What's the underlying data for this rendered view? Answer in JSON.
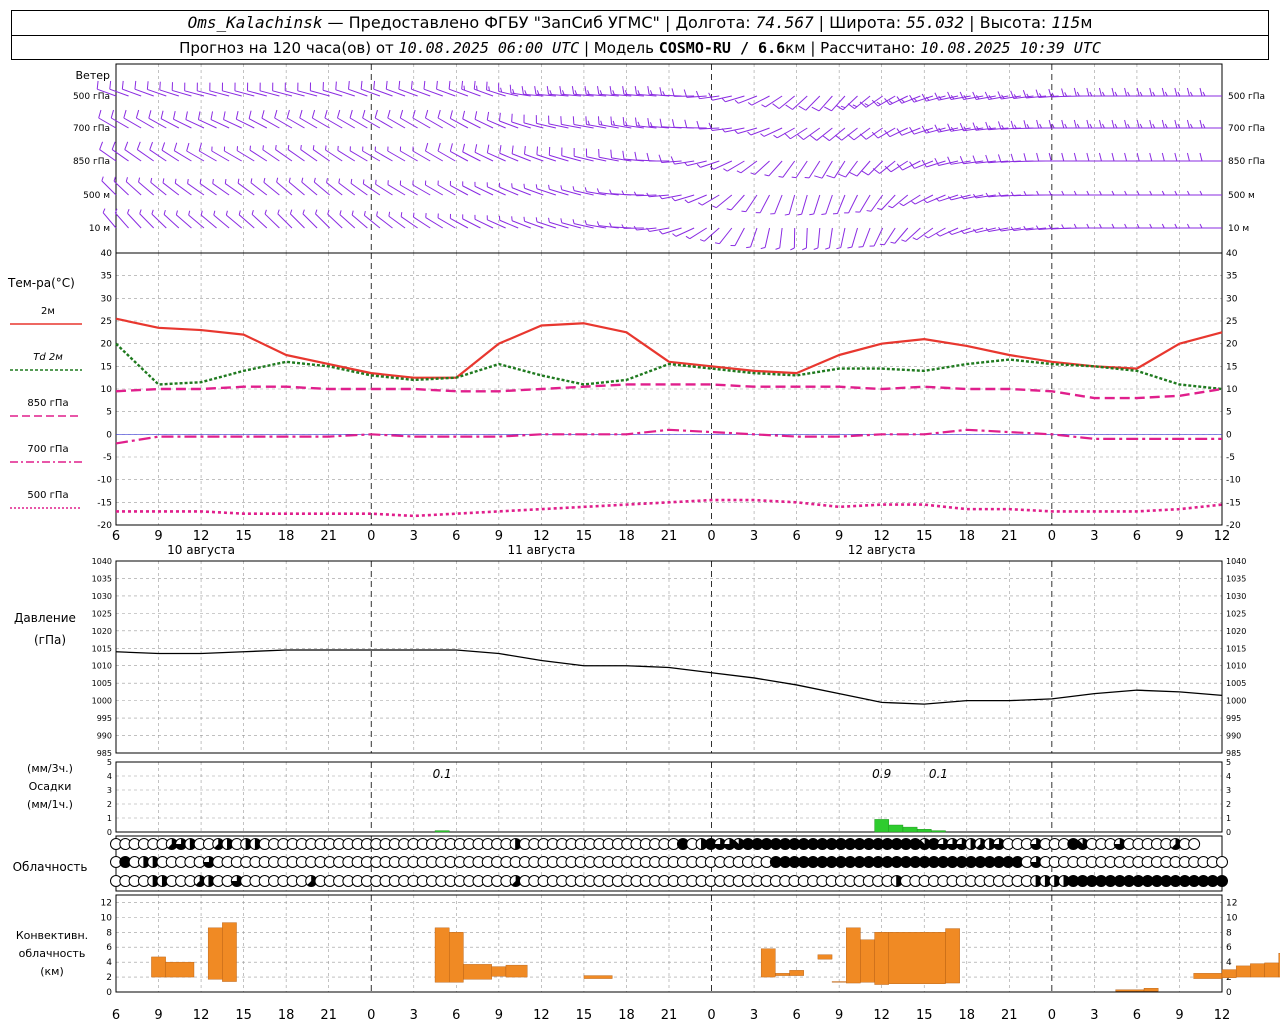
{
  "header": {
    "station": "Oms_Kalachinsk",
    "provided_by": "Предоставлено ФГБУ \"ЗапСиб УГМС\"",
    "lon_label": "Долгота:",
    "lon_value": "74.567",
    "lat_label": "Широта:",
    "lat_value": "55.032",
    "alt_label": "Высота:",
    "alt_value": "115",
    "alt_unit": "м",
    "forecast_label": "Прогноз на 120 часа(ов) от",
    "forecast_start": "10.08.2025 06:00 UTC",
    "model_label": "Модель",
    "model_name": "COSMO-RU / 6.6",
    "model_unit": "км",
    "calc_label": "Рассчитано:",
    "calc_time": "10.08.2025 10:39 UTC"
  },
  "colors": {
    "wind": "#8a2be2",
    "t2m": "#e8372f",
    "td2m": "#1f7a1f",
    "t850": "#e01f8c",
    "t700": "#e01f8c",
    "t500": "#e01f8c",
    "pressure": "#000000",
    "precip": "#2ecc2e",
    "convective": "#f08a24",
    "grid": "#9a9a9a"
  },
  "wind_panel": {
    "title": "Ветер",
    "levels": [
      "500 гПа",
      "700 гПа",
      "850 гПа",
      "500 м",
      "10  м"
    ]
  },
  "temp_panel": {
    "title": "Тем-ра(°C)",
    "legend": [
      "2м",
      "Td 2м",
      "850 гПа",
      "700 гПа",
      "500 гПа"
    ]
  },
  "pressure_panel": {
    "title": "Давление",
    "unit": "(гПа)"
  },
  "precip_panel": {
    "labels": [
      "(мм/3ч.)",
      "Осадки",
      "(мм/1ч.)"
    ]
  },
  "cloud_panel": {
    "title": "Облачность"
  },
  "conv_panel": {
    "labels": [
      "Конвективн.",
      "облачность",
      "(км)"
    ]
  },
  "time_axis": {
    "tick_labels": [
      "6",
      "9",
      "12",
      "15",
      "18",
      "21",
      "0",
      "3",
      "6",
      "9",
      "12",
      "15",
      "18",
      "21",
      "0",
      "3",
      "6",
      "9",
      "12",
      "15",
      "18",
      "21",
      "0",
      "3",
      "6",
      "9",
      "12"
    ],
    "dates": [
      "10 августа",
      "11 августа",
      "12 августа"
    ]
  },
  "chart_data": [
    {
      "type": "line",
      "name": "wind barbs",
      "x_hours": [
        0,
        3,
        6,
        9,
        12,
        15,
        18,
        21,
        24,
        27,
        30,
        33,
        36,
        39,
        42,
        45,
        48,
        51,
        54,
        57,
        60,
        63,
        66,
        69,
        72
      ],
      "levels": [
        "500 гПа",
        "700 гПа",
        "850 гПа",
        "500 м",
        "10  м"
      ],
      "direction_deg": [
        [
          290,
          290,
          285,
          285,
          285,
          285,
          290,
          290,
          290,
          290,
          275,
          275,
          275,
          275,
          265,
          250,
          230,
          220,
          235,
          250,
          260,
          260,
          265,
          270,
          270
        ],
        [
          300,
          300,
          295,
          295,
          300,
          300,
          300,
          300,
          300,
          295,
          285,
          280,
          280,
          275,
          270,
          255,
          240,
          230,
          235,
          250,
          260,
          265,
          270,
          270,
          270
        ],
        [
          305,
          305,
          300,
          300,
          305,
          305,
          300,
          300,
          300,
          295,
          290,
          285,
          280,
          270,
          255,
          235,
          215,
          210,
          225,
          245,
          260,
          265,
          270,
          270,
          270
        ],
        [
          315,
          310,
          305,
          305,
          310,
          310,
          305,
          300,
          300,
          295,
          290,
          285,
          275,
          265,
          245,
          215,
          195,
          200,
          215,
          240,
          255,
          265,
          270,
          270,
          270
        ],
        [
          320,
          315,
          310,
          310,
          315,
          315,
          310,
          305,
          300,
          295,
          290,
          285,
          275,
          260,
          235,
          200,
          180,
          190,
          205,
          230,
          250,
          260,
          265,
          270,
          270
        ]
      ],
      "speed_ms": [
        [
          12,
          12,
          12,
          11,
          10,
          10,
          10,
          11,
          12,
          13,
          14,
          15,
          16,
          16,
          10,
          6,
          8,
          12,
          14,
          14,
          15,
          16,
          16,
          16,
          16
        ],
        [
          10,
          10,
          10,
          9,
          8,
          8,
          8,
          9,
          10,
          11,
          11,
          12,
          13,
          13,
          9,
          6,
          7,
          10,
          12,
          12,
          13,
          13,
          14,
          14,
          14
        ],
        [
          8,
          8,
          8,
          7,
          6,
          6,
          6,
          7,
          8,
          8,
          8,
          9,
          10,
          10,
          7,
          5,
          6,
          8,
          9,
          9,
          10,
          10,
          10,
          10,
          10
        ],
        [
          6,
          6,
          6,
          5,
          5,
          5,
          5,
          5,
          6,
          6,
          6,
          6,
          7,
          7,
          5,
          5,
          5,
          6,
          6,
          6,
          7,
          7,
          7,
          7,
          7
        ],
        [
          4,
          4,
          4,
          3,
          3,
          3,
          3,
          3,
          4,
          4,
          4,
          4,
          5,
          4,
          3,
          3,
          3,
          4,
          4,
          4,
          5,
          5,
          5,
          5,
          5
        ]
      ]
    },
    {
      "type": "line",
      "title": "Тем-ра(°C)",
      "x_hours": [
        0,
        3,
        6,
        9,
        12,
        15,
        18,
        21,
        24,
        27,
        30,
        33,
        36,
        39,
        42,
        45,
        48,
        51,
        54,
        57,
        60,
        63,
        66,
        69,
        72,
        75,
        78
      ],
      "ylim": [
        -20,
        40
      ],
      "series": [
        {
          "name": "2м",
          "values": [
            25.5,
            23.5,
            23,
            22,
            17.5,
            15.5,
            13.5,
            12.5,
            12.5,
            20,
            24,
            24.5,
            22.5,
            16,
            15,
            14,
            13.5,
            17.5,
            20,
            21,
            19.5,
            17.5,
            16,
            15,
            14.5,
            20,
            22.5
          ]
        },
        {
          "name": "Td 2м",
          "values": [
            20,
            11,
            11.5,
            14,
            16,
            15,
            13,
            12,
            12.5,
            15.5,
            13,
            11,
            12,
            15.5,
            14.5,
            13.5,
            13,
            14.5,
            14.5,
            14,
            15.5,
            16.5,
            15.5,
            15,
            14,
            11,
            10
          ]
        },
        {
          "name": "850 гПа",
          "values": [
            9.5,
            10,
            10,
            10.5,
            10.5,
            10,
            10,
            10,
            9.5,
            9.5,
            10,
            10.5,
            11,
            11,
            11,
            10.5,
            10.5,
            10.5,
            10,
            10.5,
            10,
            10,
            9.5,
            8,
            8,
            8.5,
            10
          ]
        },
        {
          "name": "700 гПа",
          "values": [
            -2,
            -0.5,
            -0.5,
            -0.5,
            -0.5,
            -0.5,
            0,
            -0.5,
            -0.5,
            -0.5,
            0,
            0,
            0,
            1,
            0.5,
            0,
            -0.5,
            -0.5,
            0,
            0,
            1,
            0.5,
            0,
            -1,
            -1,
            -1,
            -1
          ]
        },
        {
          "name": "500 гПа",
          "values": [
            -17,
            -17,
            -17,
            -17.5,
            -17.5,
            -17.5,
            -17.5,
            -18,
            -17.5,
            -17,
            -16.5,
            -16,
            -15.5,
            -15,
            -14.5,
            -14.5,
            -15,
            -16,
            -15.5,
            -15.5,
            -16.5,
            -16.5,
            -17,
            -17,
            -17,
            -16.5,
            -15.5
          ]
        }
      ]
    },
    {
      "type": "line",
      "title": "Давление",
      "x_hours": [
        0,
        3,
        6,
        9,
        12,
        15,
        18,
        21,
        24,
        27,
        30,
        33,
        36,
        39,
        42,
        45,
        48,
        51,
        54,
        57,
        60,
        63,
        66,
        69,
        72,
        75,
        78
      ],
      "ylim": [
        985,
        1040
      ],
      "series": [
        {
          "name": "Давление",
          "values": [
            1014,
            1013.5,
            1013.5,
            1014,
            1014.5,
            1014.5,
            1014.5,
            1014.5,
            1014.5,
            1013.5,
            1011.5,
            1010,
            1010,
            1009.5,
            1008,
            1006.5,
            1004.5,
            1002,
            999.5,
            999,
            1000,
            1000,
            1000.5,
            1002,
            1003,
            1002.5,
            1001.5
          ]
        }
      ]
    },
    {
      "type": "bar",
      "title": "Осадки",
      "x_hours": [
        23,
        54,
        55,
        56,
        57,
        58
      ],
      "values": [
        0.1,
        0.9,
        0.5,
        0.35,
        0.2,
        0.1
      ],
      "annotations": [
        "0.1",
        "0.9",
        "0.1"
      ],
      "ylim": [
        0,
        5
      ]
    },
    {
      "type": "table",
      "title": "Облачность",
      "rows": [
        "high",
        "middle",
        "low"
      ],
      "cover_octas": [
        [
          0,
          0,
          0,
          0,
          0,
          0,
          5,
          6,
          4,
          0,
          0,
          5,
          4,
          0,
          4,
          4,
          0,
          0,
          0,
          0,
          0,
          0,
          0,
          0,
          0,
          0,
          0,
          0,
          0,
          0,
          0,
          0,
          0,
          0,
          0,
          0,
          0,
          0,
          0,
          0,
          0,
          0,
          0,
          4,
          0,
          0,
          0,
          0,
          0,
          0,
          0,
          0,
          0,
          0,
          0,
          0,
          0,
          0,
          0,
          0,
          0,
          8,
          0,
          4,
          8,
          6,
          6,
          7,
          8,
          8,
          8,
          8,
          8,
          8,
          8,
          8,
          8,
          8,
          8,
          8,
          8,
          8,
          8,
          8,
          8,
          8,
          8,
          7,
          8,
          6,
          6,
          6,
          4,
          5,
          4,
          6,
          0,
          0,
          0,
          6,
          0,
          0,
          0,
          8,
          7,
          0,
          0,
          0,
          6,
          0,
          0,
          0,
          0,
          0,
          5,
          0,
          0
        ],
        [
          0,
          8,
          0,
          4,
          4,
          0,
          0,
          0,
          0,
          0,
          6,
          0,
          0,
          0,
          0,
          0,
          0,
          0,
          0,
          0,
          0,
          0,
          0,
          0,
          0,
          0,
          0,
          0,
          0,
          0,
          0,
          0,
          0,
          0,
          0,
          0,
          0,
          0,
          0,
          0,
          0,
          0,
          0,
          0,
          0,
          0,
          0,
          0,
          0,
          0,
          0,
          0,
          0,
          0,
          0,
          0,
          0,
          0,
          0,
          0,
          0,
          0,
          0,
          0,
          0,
          0,
          0,
          0,
          0,
          0,
          0,
          8,
          8,
          8,
          8,
          8,
          8,
          8,
          8,
          8,
          8,
          8,
          8,
          8,
          8,
          8,
          8,
          8,
          8,
          8,
          8,
          8,
          8,
          8,
          8,
          8,
          8,
          8,
          0,
          6,
          0,
          0,
          0,
          0,
          0,
          0,
          0,
          0,
          0,
          0,
          0,
          0,
          0,
          0,
          0,
          0,
          0,
          0,
          0,
          0,
          0,
          8
        ],
        [
          0,
          0,
          0,
          0,
          4,
          4,
          0,
          0,
          0,
          5,
          4,
          0,
          0,
          6,
          0,
          0,
          0,
          0,
          0,
          0,
          0,
          5,
          0,
          0,
          0,
          0,
          0,
          0,
          0,
          0,
          0,
          0,
          0,
          0,
          0,
          0,
          0,
          0,
          0,
          0,
          0,
          0,
          0,
          5,
          0,
          0,
          0,
          0,
          0,
          0,
          0,
          0,
          0,
          0,
          0,
          0,
          0,
          0,
          0,
          0,
          0,
          0,
          0,
          0,
          0,
          0,
          0,
          0,
          0,
          0,
          0,
          0,
          0,
          0,
          0,
          0,
          0,
          0,
          0,
          0,
          0,
          0,
          0,
          0,
          4,
          0,
          0,
          0,
          0,
          0,
          0,
          0,
          0,
          0,
          0,
          0,
          0,
          0,
          0,
          4,
          4,
          4,
          4,
          8,
          8,
          8,
          8,
          8,
          8,
          8,
          8,
          8,
          8,
          8,
          8,
          8,
          8,
          8,
          8,
          8,
          0
        ]
      ]
    },
    {
      "type": "bar",
      "title": "Конвективн. облачность (км)",
      "ylim": [
        0,
        13
      ],
      "bars": [
        {
          "x": [
            2.5,
            3.5
          ],
          "bottom": 2,
          "top": 4.7
        },
        {
          "x": [
            3.5,
            5.5
          ],
          "bottom": 2,
          "top": 4
        },
        {
          "x": [
            6.5,
            7.5
          ],
          "bottom": 1.7,
          "top": 8.6
        },
        {
          "x": [
            7.5,
            8.5
          ],
          "bottom": 1.4,
          "top": 9.3
        },
        {
          "x": [
            22.5,
            23.5
          ],
          "bottom": 1.3,
          "top": 8.6
        },
        {
          "x": [
            23.5,
            24.5
          ],
          "bottom": 1.3,
          "top": 8
        },
        {
          "x": [
            24.5,
            26.5
          ],
          "bottom": 1.7,
          "top": 3.7
        },
        {
          "x": [
            26.5,
            27.5
          ],
          "bottom": 2.1,
          "top": 3.4
        },
        {
          "x": [
            27.5,
            29
          ],
          "bottom": 2,
          "top": 3.6
        },
        {
          "x": [
            33,
            35
          ],
          "bottom": 1.8,
          "top": 2.2
        },
        {
          "x": [
            45.5,
            46.5
          ],
          "bottom": 2,
          "top": 5.8
        },
        {
          "x": [
            46.5,
            47.5
          ],
          "bottom": 2.2,
          "top": 2.5
        },
        {
          "x": [
            47.5,
            48.5
          ],
          "bottom": 2.2,
          "top": 2.9
        },
        {
          "x": [
            49.5,
            50.5
          ],
          "bottom": 4.4,
          "top": 5
        },
        {
          "x": [
            50.5,
            51.5
          ],
          "bottom": 1.3,
          "top": 1.4
        },
        {
          "x": [
            51.5,
            52.5
          ],
          "bottom": 1.2,
          "top": 8.6
        },
        {
          "x": [
            52.5,
            53.5
          ],
          "bottom": 1.3,
          "top": 7
        },
        {
          "x": [
            53.5,
            54.5
          ],
          "bottom": 1,
          "top": 8
        },
        {
          "x": [
            54.5,
            58.5
          ],
          "bottom": 1.1,
          "top": 8
        },
        {
          "x": [
            58.5,
            59.5
          ],
          "bottom": 1.2,
          "top": 8.5
        },
        {
          "x": [
            70.5,
            72.5
          ],
          "bottom": 0.1,
          "top": 0.3
        },
        {
          "x": [
            72.5,
            73.5
          ],
          "bottom": 0.1,
          "top": 0.5
        },
        {
          "x": [
            76,
            78
          ],
          "bottom": 1.8,
          "top": 2.5
        },
        {
          "x": [
            78,
            79
          ],
          "bottom": 1.9,
          "top": 3
        },
        {
          "x": [
            79,
            80
          ],
          "bottom": 2,
          "top": 3.5
        },
        {
          "x": [
            80,
            81
          ],
          "bottom": 2,
          "top": 3.8
        },
        {
          "x": [
            81,
            82
          ],
          "bottom": 2,
          "top": 3.9
        },
        {
          "x": [
            82,
            82.5
          ],
          "bottom": 2,
          "top": 5.2
        }
      ]
    }
  ]
}
